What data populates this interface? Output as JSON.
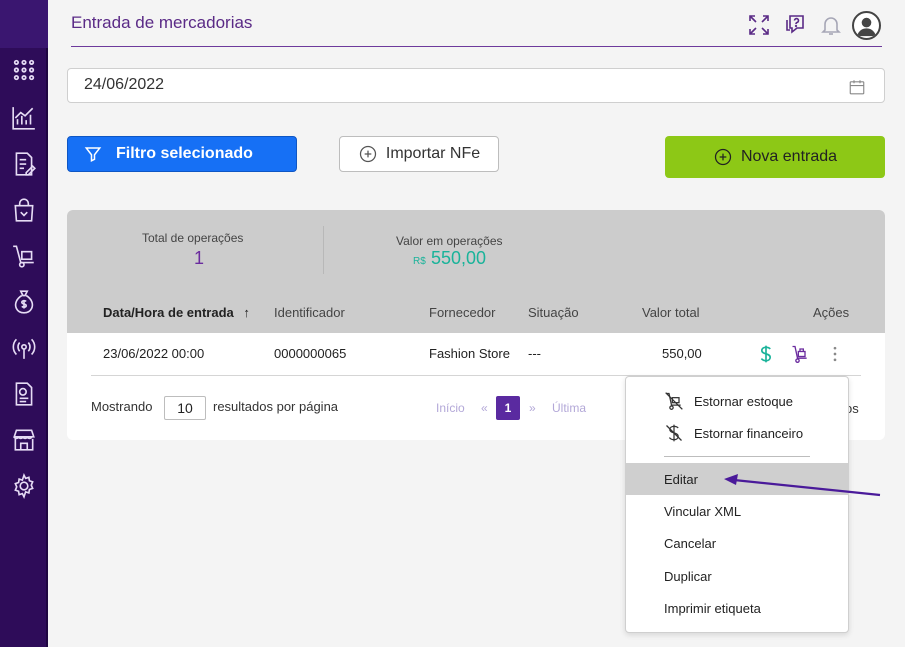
{
  "header": {
    "title": "Entrada de mercadorias"
  },
  "date_filter": {
    "value": "24/06/2022"
  },
  "toolbar": {
    "filter_label": "Filtro selecionado",
    "import_label": "Importar NFe",
    "new_label": "Nova entrada"
  },
  "summary": {
    "total_label": "Total de operações",
    "total_value": "1",
    "amount_label": "Valor em operações",
    "currency": "R$",
    "amount_value": "550,00"
  },
  "table": {
    "columns": [
      "Data/Hora de entrada",
      "Identificador",
      "Fornecedor",
      "Situação",
      "Valor total",
      "Ações"
    ],
    "rows": [
      {
        "datetime": "23/06/2022 00:00",
        "id": "0000000065",
        "supplier": "Fashion Store",
        "status": "---",
        "total": "550,00"
      }
    ]
  },
  "pagination": {
    "showing_label": "Mostrando",
    "per_page": "10",
    "per_page_suffix": "resultados por página",
    "first": "Início",
    "prev": "«",
    "current": "1",
    "next": "»",
    "last": "Última",
    "right_fragment": "os"
  },
  "action_menu": {
    "items": [
      {
        "label": "Estornar estoque",
        "icon": "cart-off-icon"
      },
      {
        "label": "Estornar financeiro",
        "icon": "dollar-off-icon"
      },
      {
        "label": "Editar"
      },
      {
        "label": "Vincular XML"
      },
      {
        "label": "Cancelar"
      },
      {
        "label": "Duplicar"
      },
      {
        "label": "Imprimir etiqueta"
      }
    ],
    "highlighted": "Editar"
  },
  "colors": {
    "sidebar": "#2e0c59",
    "accent_purple": "#5a2aa0",
    "primary_blue": "#1670f5",
    "success_green": "#8dc816",
    "teal": "#1ab39a",
    "annotation_arrow": "#4a1a9a"
  }
}
